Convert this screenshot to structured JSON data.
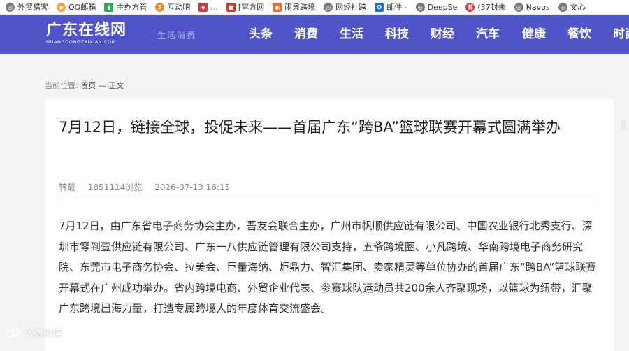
{
  "bookmarks": [
    {
      "label": "外贸猎客",
      "icon": "globe-icon",
      "color": "#7a7a7a"
    },
    {
      "label": "QQ邮箱",
      "icon": "qq-mail-icon",
      "color": "#f2a33a"
    },
    {
      "label": "主办方管",
      "icon": "doc-icon",
      "color": "#2fa84f"
    },
    {
      "label": "互动吧",
      "icon": "hudongba-icon",
      "color": "#f08a24"
    },
    {
      "label": "...",
      "icon": "megaphone-icon",
      "color": "#c23b3b"
    },
    {
      "label": "[官方网",
      "icon": "site-icon",
      "color": "#d9362c"
    },
    {
      "label": "雨果跨境",
      "icon": "cifnews-icon",
      "color": "#f26c2b"
    },
    {
      "label": "网经社跨",
      "icon": "globe-icon",
      "color": "#7a7a7a"
    },
    {
      "label": "邮件 -",
      "icon": "outlook-icon",
      "color": "#1f6fc9"
    },
    {
      "label": "DeepSe",
      "icon": "globe-icon",
      "color": "#7a7a7a"
    },
    {
      "label": "(37封未",
      "icon": "mail-163-icon",
      "color": "#d9362c"
    },
    {
      "label": "Navos",
      "icon": "globe-icon",
      "color": "#7a7a7a"
    },
    {
      "label": "文心",
      "icon": "globe-icon",
      "color": "#7a7a7a"
    }
  ],
  "header": {
    "logo_main": "广东在线网",
    "logo_sub": "GUANGDONGZAIXIAN.COM",
    "tagline": "生活消费",
    "nav": [
      "头条",
      "消费",
      "生活",
      "科技",
      "财经",
      "汽车",
      "健康",
      "餐饮",
      "时尚"
    ]
  },
  "breadcrumb": {
    "label": "当前位置:",
    "home": "首页",
    "sep": "—",
    "current": "正文"
  },
  "article": {
    "title": "7月12日，链接全球，投促未来——首届广东“跨BA”篮球联赛开幕式圆满举办",
    "source": "转载",
    "views": "1851114浏览",
    "datetime": "2026-07-13 16:15",
    "body": "7月12日，由广东省电子商务协会主办，吾友会联合主办，广州市帆顺供应链有限公司、中国农业银行北秀支行、深圳市零到壹供应链有限公司、广东一八供应链管理有限公司支持，五爷跨境圈、小凡跨境、华南跨境电子商务研究院、东莞市电子商务协会、拉美会、巨量海纳、炬鼎力、智汇集团、卖家精灵等单位协办的首届广东“跨BA”篮球联赛开幕式在广州成功举办。省内跨境电商、外贸企业代表、参赛球队运动员共200余人齐聚现场，以篮球为纽带，汇聚广东跨境出海力量，打造专属跨境人的年度体育交流盛会。"
  },
  "watermark": {
    "text": "大数跨境"
  },
  "colors": {
    "header_bg": "#4f55c8",
    "page_bg": "#f4f4f4",
    "card_bg": "#ffffff"
  }
}
